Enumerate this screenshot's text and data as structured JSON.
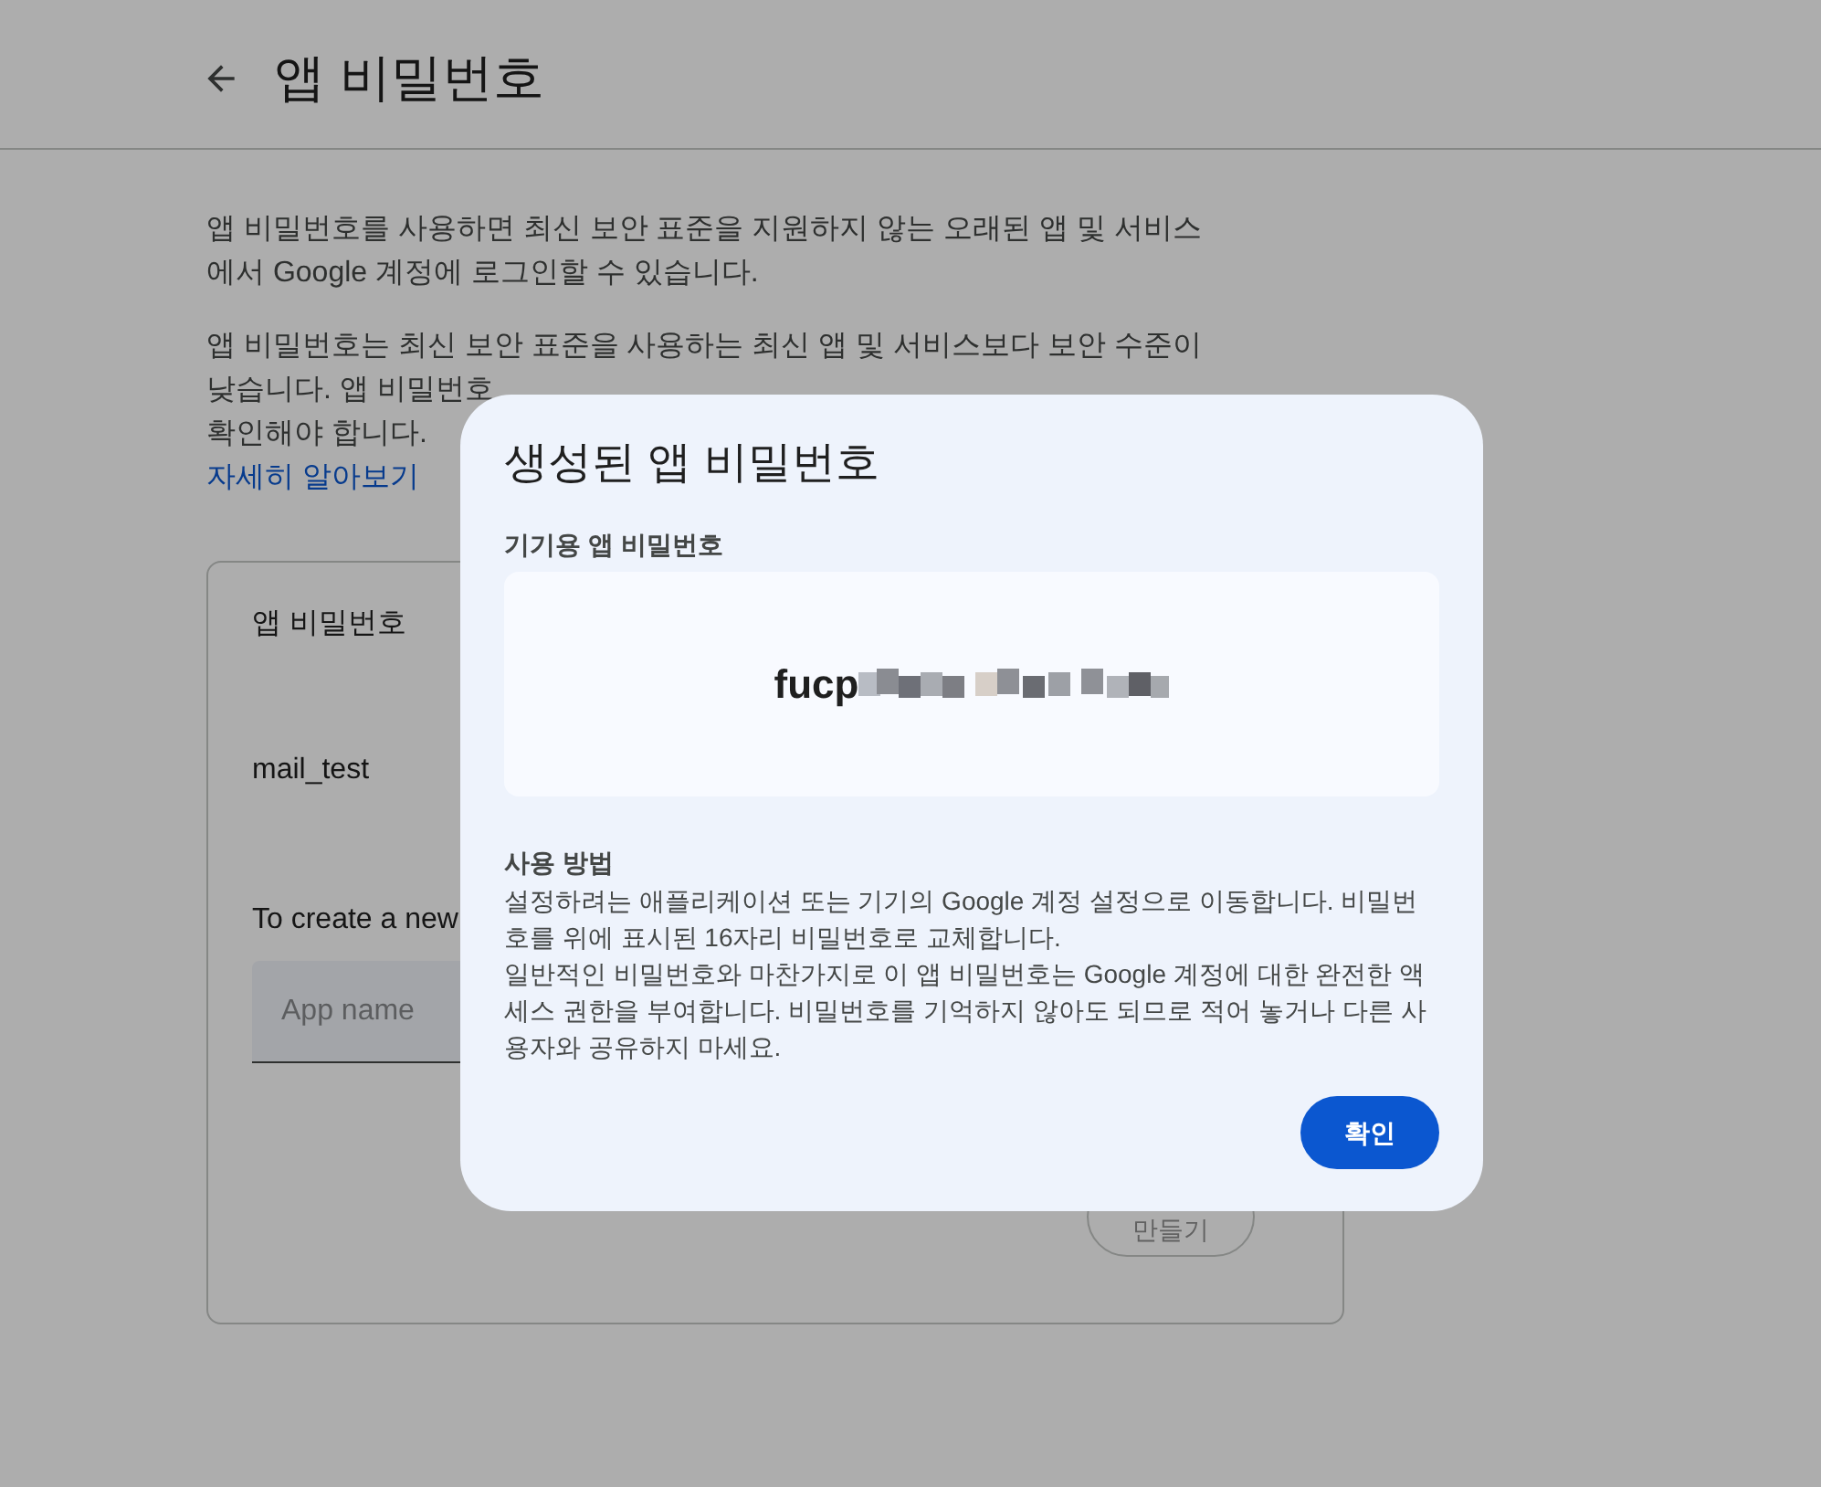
{
  "header": {
    "title": "앱 비밀번호"
  },
  "intro": {
    "paragraphs": [
      "앱 비밀번호를 사용하면 최신 보안 표준을 지원하지 않는 오래된 앱 및 서비스에서 Google 계정에 로그인할 수 있습니다.",
      "앱 비밀번호는 최신 보안 표준을 사용하는 최신 앱 및 서비스보다 보안 수준이 낮습니다. 앱 비밀번호",
      "확인해야 합니다."
    ],
    "learn_more": "자세히 알아보기"
  },
  "card": {
    "title": "앱 비밀번호",
    "entries": [
      "mail_test"
    ],
    "create_prompt": "To create a new",
    "app_name_field": {
      "placeholder": "App name"
    },
    "create_button": "만들기"
  },
  "dialog": {
    "title": "생성된 앱 비밀번호",
    "password_label": "기기용 앱 비밀번호",
    "password_visible": "fucp",
    "usage_title": "사용 방법",
    "usage_paragraphs": [
      "설정하려는 애플리케이션 또는 기기의 Google 계정 설정으로 이동합니다. 비밀번호를 위에 표시된 16자리 비밀번호로 교체합니다.",
      "일반적인 비밀번호와 마찬가지로 이 앱 비밀번호는 Google 계정에 대한 완전한 액세스 권한을 부여합니다. 비밀번호를 기억하지 않아도 되므로 적어 놓거나 다른 사용자와 공유하지 마세요."
    ],
    "confirm_button": "확인"
  }
}
